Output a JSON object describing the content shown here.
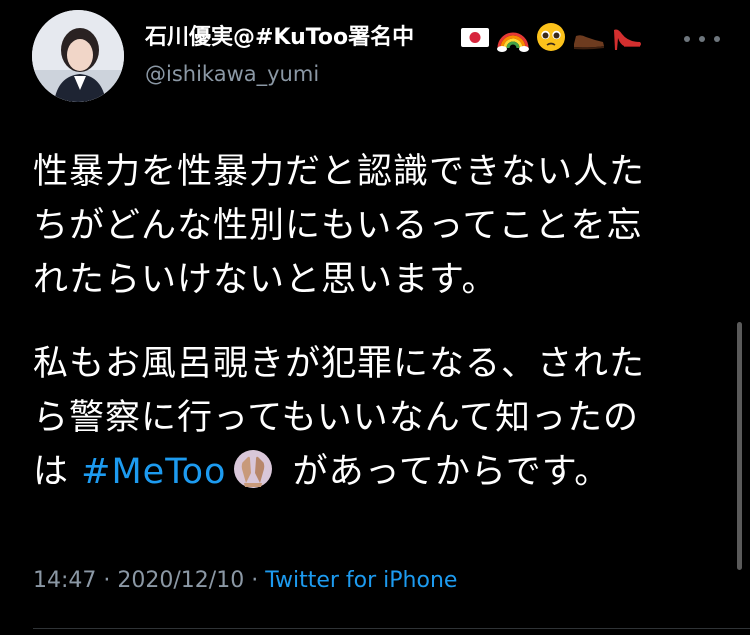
{
  "tweet": {
    "display_name": "石川優実@#KuToo署名中",
    "name_emojis": [
      "japan-flag-icon",
      "rainbow-icon",
      "pleading-face-icon",
      "dress-shoe-icon",
      "high-heel-icon"
    ],
    "handle": "@ishikawa_yumi",
    "paragraph1": [
      "性暴力を性暴力だと認識できない人た",
      "ちがどんな性別にもいるってことを忘",
      "れたらいけないと思います。"
    ],
    "paragraph2": [
      "私もお風呂覗きが犯罪になる、された",
      "ら警察に行ってもいいなんて知ったの"
    ],
    "paragraph2_last": {
      "before": "は ",
      "hashtag": "#MeToo",
      "emoji": "raised-hands-icon",
      "after": " があってからです。"
    },
    "time": "14:47",
    "date": "2020/12/10",
    "separator": " · ",
    "source": "Twitter for iPhone"
  },
  "colors": {
    "background": "#000000",
    "text": "#ffffff",
    "secondary": "#8b98a5",
    "link": "#1d9bf0"
  }
}
